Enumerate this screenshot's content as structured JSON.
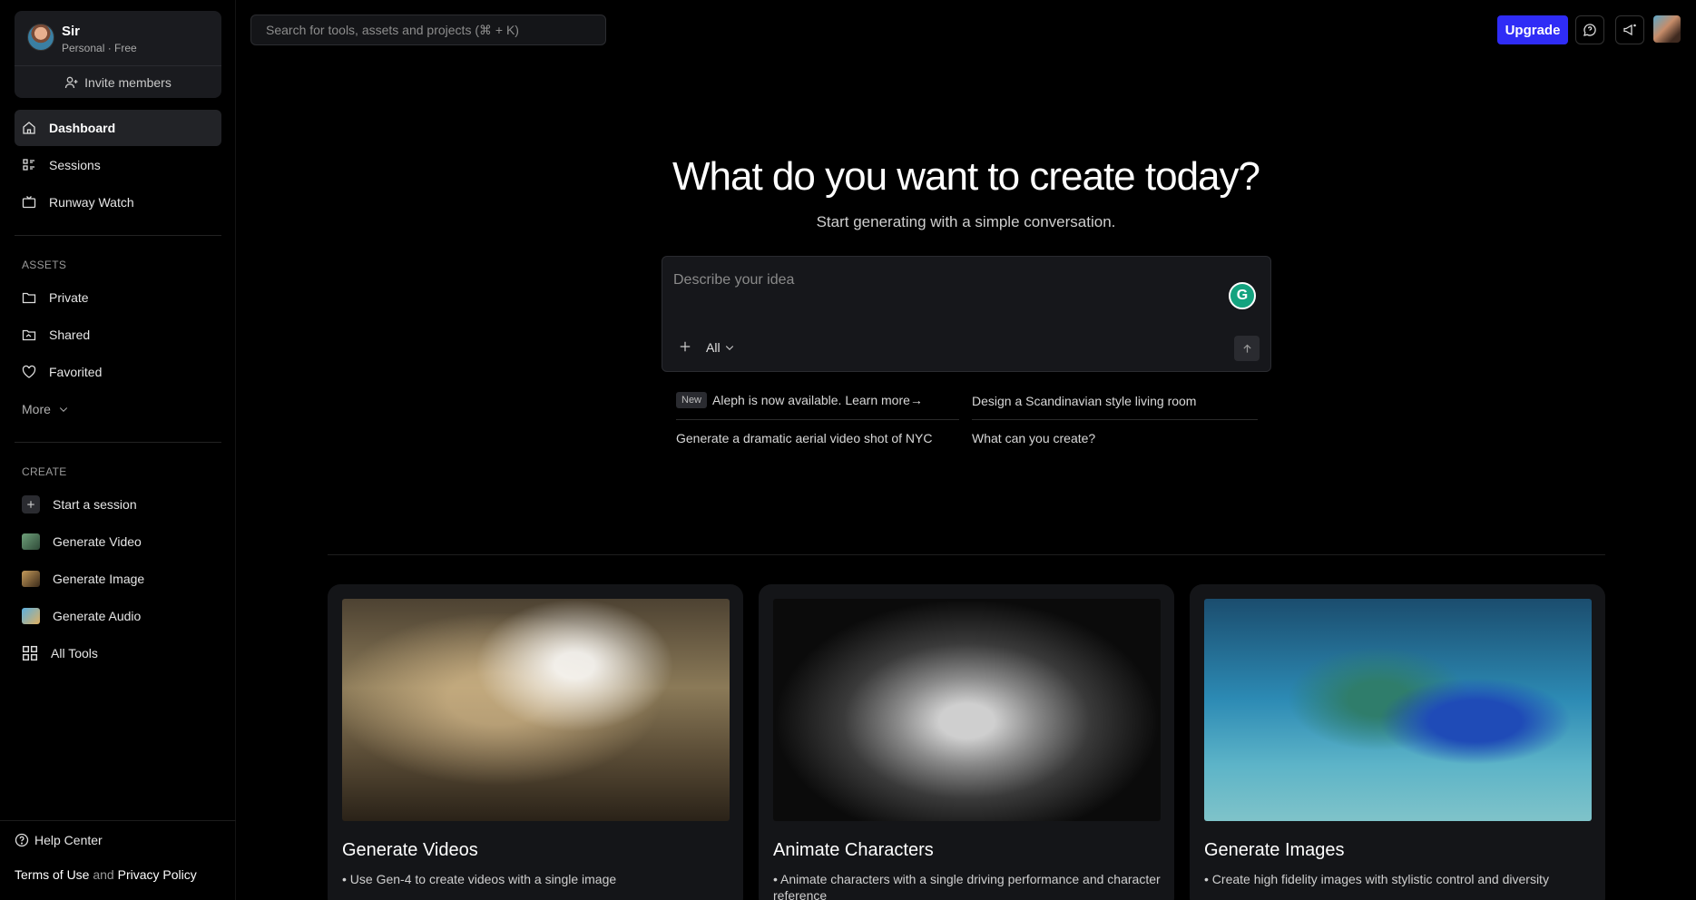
{
  "account": {
    "name": "Sir",
    "plan": "Personal · Free",
    "invite_label": "Invite members"
  },
  "nav": [
    {
      "label": "Dashboard",
      "icon": "home-icon"
    },
    {
      "label": "Sessions",
      "icon": "sessions-icon"
    },
    {
      "label": "Runway Watch",
      "icon": "tv-icon"
    }
  ],
  "assets": {
    "heading": "ASSETS",
    "items": [
      {
        "label": "Private",
        "icon": "folder-icon"
      },
      {
        "label": "Shared",
        "icon": "shared-folder-icon"
      },
      {
        "label": "Favorited",
        "icon": "heart-icon"
      }
    ],
    "more_label": "More"
  },
  "create": {
    "heading": "CREATE",
    "items": [
      {
        "label": "Start a session"
      },
      {
        "label": "Generate Video"
      },
      {
        "label": "Generate Image"
      },
      {
        "label": "Generate Audio"
      },
      {
        "label": "All Tools"
      }
    ]
  },
  "footer": {
    "help_label": "Help Center",
    "terms_label": "Terms of Use",
    "and_text": "and",
    "privacy_label": "Privacy Policy"
  },
  "search": {
    "placeholder": "Search for tools, assets and projects (⌘ + K)"
  },
  "topbar": {
    "upgrade_label": "Upgrade"
  },
  "hero": {
    "title": "What do you want to create today?",
    "subtitle": "Start generating with a simple conversation."
  },
  "prompt": {
    "placeholder": "Describe your idea",
    "filter_label": "All"
  },
  "suggestions": {
    "badge": "New",
    "items": [
      "Aleph is now available. Learn more→",
      "Design a Scandinavian style living room",
      "Generate a dramatic aerial video shot of NYC",
      "What can you create?"
    ]
  },
  "cards": [
    {
      "title": "Generate Videos",
      "desc": "• Use Gen-4 to create videos with a single image"
    },
    {
      "title": "Animate Characters",
      "desc": "• Animate characters with a single driving performance and character reference"
    },
    {
      "title": "Generate Images",
      "desc": "• Create high fidelity images with stylistic control and diversity"
    }
  ],
  "colors": {
    "accent": "#2f2cf6",
    "background": "#000000",
    "panel": "#1a1b1f"
  }
}
